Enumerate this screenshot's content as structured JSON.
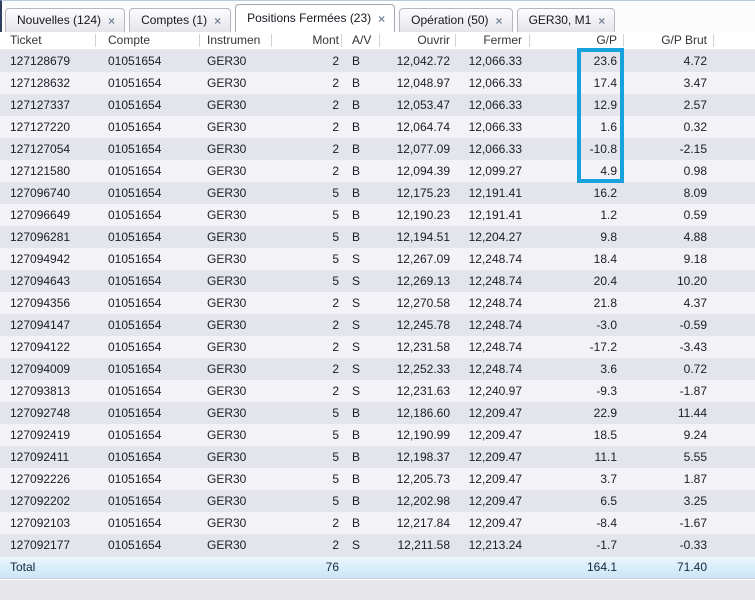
{
  "icons": {
    "close": "×"
  },
  "tabs": [
    {
      "label": "Nouvelles (124)",
      "active": false
    },
    {
      "label": "Comptes (1)",
      "active": false
    },
    {
      "label": "Positions Fermées (23)",
      "active": true
    },
    {
      "label": "Opération (50)",
      "active": false
    },
    {
      "label": "GER30, M1",
      "active": false
    }
  ],
  "table": {
    "columns": [
      {
        "key": "ticket",
        "label": "Ticket"
      },
      {
        "key": "compte",
        "label": "Compte"
      },
      {
        "key": "instrument",
        "label": "Instrumen"
      },
      {
        "key": "mont",
        "label": "Mont"
      },
      {
        "key": "av",
        "label": "A/V"
      },
      {
        "key": "ouvrir",
        "label": "Ouvrir"
      },
      {
        "key": "fermer",
        "label": "Fermer"
      },
      {
        "key": "gp",
        "label": "G/P"
      },
      {
        "key": "gp_brut",
        "label": "G/P Brut"
      }
    ],
    "rows": [
      [
        "127128679",
        "01051654",
        "GER30",
        "2",
        "B",
        "12,042.72",
        "12,066.33",
        "23.6",
        "4.72"
      ],
      [
        "127128632",
        "01051654",
        "GER30",
        "2",
        "B",
        "12,048.97",
        "12,066.33",
        "17.4",
        "3.47"
      ],
      [
        "127127337",
        "01051654",
        "GER30",
        "2",
        "B",
        "12,053.47",
        "12,066.33",
        "12.9",
        "2.57"
      ],
      [
        "127127220",
        "01051654",
        "GER30",
        "2",
        "B",
        "12,064.74",
        "12,066.33",
        "1.6",
        "0.32"
      ],
      [
        "127127054",
        "01051654",
        "GER30",
        "2",
        "B",
        "12,077.09",
        "12,066.33",
        "-10.8",
        "-2.15"
      ],
      [
        "127121580",
        "01051654",
        "GER30",
        "2",
        "B",
        "12,094.39",
        "12,099.27",
        "4.9",
        "0.98"
      ],
      [
        "127096740",
        "01051654",
        "GER30",
        "5",
        "B",
        "12,175.23",
        "12,191.41",
        "16.2",
        "8.09"
      ],
      [
        "127096649",
        "01051654",
        "GER30",
        "5",
        "B",
        "12,190.23",
        "12,191.41",
        "1.2",
        "0.59"
      ],
      [
        "127096281",
        "01051654",
        "GER30",
        "5",
        "B",
        "12,194.51",
        "12,204.27",
        "9.8",
        "4.88"
      ],
      [
        "127094942",
        "01051654",
        "GER30",
        "5",
        "S",
        "12,267.09",
        "12,248.74",
        "18.4",
        "9.18"
      ],
      [
        "127094643",
        "01051654",
        "GER30",
        "5",
        "S",
        "12,269.13",
        "12,248.74",
        "20.4",
        "10.20"
      ],
      [
        "127094356",
        "01051654",
        "GER30",
        "2",
        "S",
        "12,270.58",
        "12,248.74",
        "21.8",
        "4.37"
      ],
      [
        "127094147",
        "01051654",
        "GER30",
        "2",
        "S",
        "12,245.78",
        "12,248.74",
        "-3.0",
        "-0.59"
      ],
      [
        "127094122",
        "01051654",
        "GER30",
        "2",
        "S",
        "12,231.58",
        "12,248.74",
        "-17.2",
        "-3.43"
      ],
      [
        "127094009",
        "01051654",
        "GER30",
        "2",
        "S",
        "12,252.33",
        "12,248.74",
        "3.6",
        "0.72"
      ],
      [
        "127093813",
        "01051654",
        "GER30",
        "2",
        "S",
        "12,231.63",
        "12,240.97",
        "-9.3",
        "-1.87"
      ],
      [
        "127092748",
        "01051654",
        "GER30",
        "5",
        "B",
        "12,186.60",
        "12,209.47",
        "22.9",
        "11.44"
      ],
      [
        "127092419",
        "01051654",
        "GER30",
        "5",
        "B",
        "12,190.99",
        "12,209.47",
        "18.5",
        "9.24"
      ],
      [
        "127092411",
        "01051654",
        "GER30",
        "5",
        "B",
        "12,198.37",
        "12,209.47",
        "11.1",
        "5.55"
      ],
      [
        "127092226",
        "01051654",
        "GER30",
        "5",
        "B",
        "12,205.73",
        "12,209.47",
        "3.7",
        "1.87"
      ],
      [
        "127092202",
        "01051654",
        "GER30",
        "5",
        "B",
        "12,202.98",
        "12,209.47",
        "6.5",
        "3.25"
      ],
      [
        "127092103",
        "01051654",
        "GER30",
        "2",
        "B",
        "12,217.84",
        "12,209.47",
        "-8.4",
        "-1.67"
      ],
      [
        "127092177",
        "01051654",
        "GER30",
        "2",
        "S",
        "12,211.58",
        "12,213.24",
        "-1.7",
        "-0.33"
      ]
    ],
    "total": {
      "label": "Total",
      "mont": "76",
      "gp": "164.1",
      "gp_brut": "71.40"
    }
  },
  "highlight": {
    "color": "#17a2de"
  }
}
